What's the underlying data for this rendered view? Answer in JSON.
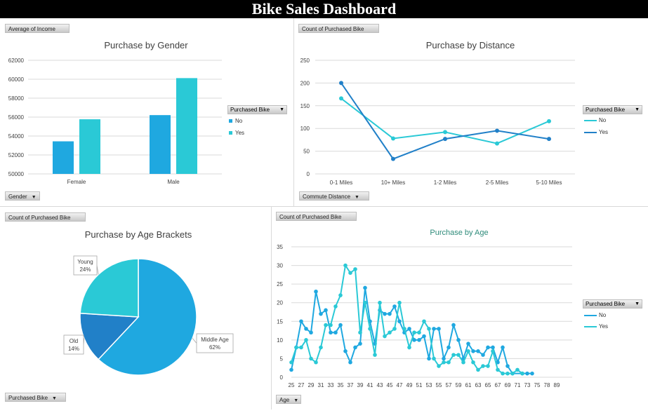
{
  "dashboard": {
    "title": "Bike Sales Dashboard"
  },
  "colors": {
    "no": "#1fa8e0",
    "yes": "#2ac9d6",
    "middle": "#1fa8e0",
    "old": "#2180c8",
    "young": "#2ac9d6",
    "age_title": "#2e8b7a"
  },
  "charts": {
    "gender": {
      "value_button": "Average of Income",
      "axis_button": "Gender",
      "legend_title": "Purchased Bike",
      "legend": [
        "No",
        "Yes"
      ]
    },
    "distance": {
      "value_button": "Count of Purchased Bike",
      "axis_button": "Commute Distance",
      "legend_title": "Purchased Bike",
      "legend": [
        "No",
        "Yes"
      ]
    },
    "agebrackets": {
      "value_button": "Count of Purchased Bike",
      "axis_button": "Purchased Bike"
    },
    "age": {
      "value_button": "Count of Purchased Bike",
      "axis_button": "Age",
      "legend_title": "Purchased Bike",
      "legend": [
        "No",
        "Yes"
      ]
    }
  },
  "chart_data": [
    {
      "type": "bar",
      "title": "Purchase by Gender",
      "categories": [
        "Female",
        "Male"
      ],
      "series": [
        {
          "name": "No",
          "values": [
            53440,
            56210
          ]
        },
        {
          "name": "Yes",
          "values": [
            55770,
            60120
          ]
        }
      ],
      "ylim": [
        50000,
        62000
      ],
      "yticks": [
        "50000",
        "52000",
        "54000",
        "56000",
        "58000",
        "60000",
        "62000"
      ],
      "grid": true,
      "legend": "right"
    },
    {
      "type": "line",
      "title": "Purchase by Distance",
      "categories": [
        "0-1 Miles",
        "10+ Miles",
        "1-2 Miles",
        "2-5 Miles",
        "5-10 Miles"
      ],
      "series": [
        {
          "name": "No",
          "values": [
            166,
            78,
            92,
            67,
            116
          ]
        },
        {
          "name": "Yes",
          "values": [
            200,
            33,
            77,
            95,
            77
          ]
        }
      ],
      "ylim": [
        0,
        250
      ],
      "yticks": [
        "0",
        "50",
        "100",
        "150",
        "200",
        "250"
      ],
      "grid": true,
      "legend": "right"
    },
    {
      "type": "pie",
      "title": "Purchase by Age Brackets",
      "labels": [
        "Middle Age",
        "Old",
        "Young"
      ],
      "values": [
        62,
        14,
        24
      ],
      "data_labels": [
        "62%",
        "14%",
        "24%"
      ]
    },
    {
      "type": "line",
      "title": "Purchase by Age",
      "x": [
        25,
        26,
        27,
        28,
        29,
        30,
        31,
        32,
        33,
        34,
        35,
        36,
        37,
        38,
        39,
        40,
        41,
        42,
        43,
        44,
        45,
        46,
        47,
        48,
        49,
        50,
        51,
        52,
        53,
        54,
        55,
        56,
        57,
        58,
        59,
        60,
        61,
        62,
        63,
        64,
        65,
        66,
        67,
        68,
        69,
        70,
        71,
        72,
        73,
        74,
        75,
        76,
        77,
        78,
        79,
        80,
        81,
        82,
        83,
        84,
        85,
        86,
        87,
        88,
        89
      ],
      "xticks": [
        "25",
        "27",
        "29",
        "31",
        "33",
        "35",
        "37",
        "39",
        "41",
        "43",
        "45",
        "47",
        "49",
        "51",
        "53",
        "55",
        "57",
        "59",
        "61",
        "63",
        "65",
        "67",
        "69",
        "71",
        "73",
        "75",
        "78",
        "89"
      ],
      "series": [
        {
          "name": "No",
          "points": [
            [
              25,
              2
            ],
            [
              26,
              8
            ],
            [
              27,
              15
            ],
            [
              28,
              13
            ],
            [
              29,
              12
            ],
            [
              30,
              23
            ],
            [
              31,
              17
            ],
            [
              32,
              18
            ],
            [
              33,
              12
            ],
            [
              34,
              12
            ],
            [
              35,
              14
            ],
            [
              36,
              7
            ],
            [
              37,
              4
            ],
            [
              38,
              8
            ],
            [
              39,
              9
            ],
            [
              40,
              24
            ],
            [
              41,
              15
            ],
            [
              42,
              9
            ],
            [
              43,
              18
            ],
            [
              44,
              17
            ],
            [
              45,
              17
            ],
            [
              46,
              19
            ],
            [
              47,
              15
            ],
            [
              48,
              12
            ],
            [
              49,
              13
            ],
            [
              50,
              10
            ],
            [
              51,
              10
            ],
            [
              52,
              11
            ],
            [
              53,
              5
            ],
            [
              54,
              13
            ],
            [
              55,
              13
            ],
            [
              56,
              5
            ],
            [
              57,
              8
            ],
            [
              58,
              14
            ],
            [
              59,
              10
            ],
            [
              60,
              5
            ],
            [
              61,
              9
            ],
            [
              62,
              7
            ],
            [
              63,
              7
            ],
            [
              64,
              6
            ],
            [
              65,
              8
            ],
            [
              66,
              8
            ],
            [
              67,
              4
            ],
            [
              68,
              8
            ],
            [
              69,
              3
            ],
            [
              70,
              1
            ],
            [
              72,
              1
            ],
            [
              73,
              1
            ],
            [
              74,
              1
            ]
          ]
        },
        {
          "name": "Yes",
          "points": [
            [
              25,
              4
            ],
            [
              26,
              8
            ],
            [
              27,
              8
            ],
            [
              28,
              10
            ],
            [
              29,
              5
            ],
            [
              30,
              4
            ],
            [
              31,
              8
            ],
            [
              32,
              14
            ],
            [
              33,
              14
            ],
            [
              34,
              19
            ],
            [
              35,
              22
            ],
            [
              36,
              30
            ],
            [
              37,
              28
            ],
            [
              38,
              29
            ],
            [
              39,
              12
            ],
            [
              40,
              20
            ],
            [
              41,
              13
            ],
            [
              42,
              6
            ],
            [
              43,
              20
            ],
            [
              44,
              11
            ],
            [
              45,
              12
            ],
            [
              46,
              13
            ],
            [
              47,
              20
            ],
            [
              48,
              13
            ],
            [
              49,
              8
            ],
            [
              50,
              12
            ],
            [
              51,
              12
            ],
            [
              52,
              15
            ],
            [
              53,
              13
            ],
            [
              54,
              5
            ],
            [
              55,
              3
            ],
            [
              56,
              4
            ],
            [
              57,
              4
            ],
            [
              58,
              6
            ],
            [
              59,
              6
            ],
            [
              60,
              4
            ],
            [
              61,
              7
            ],
            [
              62,
              4
            ],
            [
              63,
              2
            ],
            [
              64,
              3
            ],
            [
              65,
              3
            ],
            [
              66,
              7
            ],
            [
              67,
              2
            ],
            [
              68,
              1
            ],
            [
              69,
              1
            ],
            [
              70,
              1
            ],
            [
              71,
              2
            ],
            [
              72,
              1
            ]
          ]
        }
      ],
      "ylim": [
        0,
        35
      ],
      "yticks": [
        "0",
        "5",
        "10",
        "15",
        "20",
        "25",
        "30",
        "35"
      ],
      "grid": true,
      "legend": "right"
    }
  ]
}
